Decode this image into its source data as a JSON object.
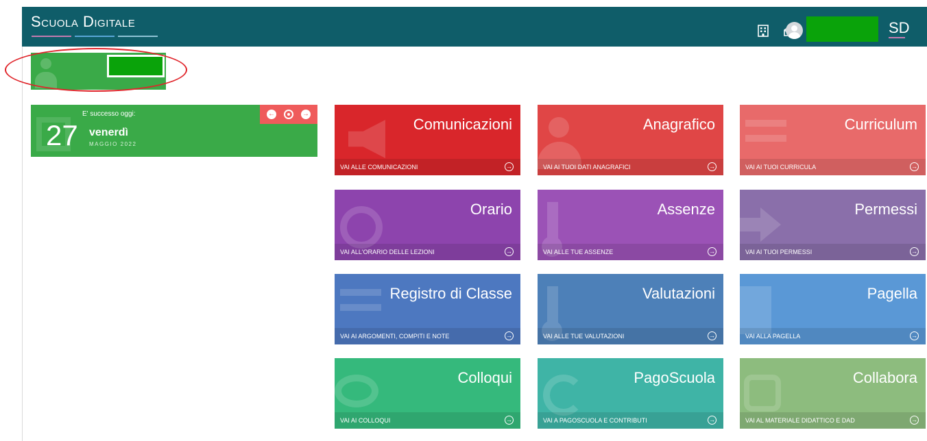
{
  "header": {
    "logo": "Scuola Digitale",
    "logo_small": "SD",
    "icons": [
      "building-icon",
      "mail-icon",
      "user-avatar-icon"
    ],
    "colors": {
      "bar": "#0f5d69",
      "accent_pink": "#c77bb0",
      "accent_blue": "#5aa7d8"
    }
  },
  "today": {
    "label": "E' successo oggi:",
    "day_number": "27",
    "day_name": "venerdì",
    "month_year": "MAGGIO 2022",
    "nav": {
      "prev": "prev-arrow-icon",
      "current": "target-icon",
      "next": "next-arrow-icon"
    }
  },
  "tiles": [
    {
      "title": "Comunicazioni",
      "link": "VAI ALLE COMUNICAZIONI",
      "color": "#d9262b",
      "icon": "megaphone-icon"
    },
    {
      "title": "Anagrafico",
      "link": "VAI AI TUOI DATI ANAGRAFICI",
      "color": "#e04646",
      "icon": "person-icon"
    },
    {
      "title": "Curriculum",
      "link": "VAI AI TUOI CURRICULA",
      "color": "#e86a6a",
      "icon": "list-icon"
    },
    {
      "title": "Orario",
      "link": "VAI ALL'ORARIO DELLE LEZIONI",
      "color": "#8d44ad",
      "icon": "clock-icon"
    },
    {
      "title": "Assenze",
      "link": "VAI ALLE TUE ASSENZE",
      "color": "#9b52b6",
      "icon": "key-icon"
    },
    {
      "title": "Permessi",
      "link": "VAI AI TUOI PERMESSI",
      "color": "#8a6faa",
      "icon": "exit-icon"
    },
    {
      "title": "Registro di Classe",
      "link": "VAI AI ARGOMENTI, COMPITI E NOTE",
      "color": "#4d78c0",
      "icon": "book-icon"
    },
    {
      "title": "Valutazioni",
      "link": "VAI ALLE TUE VALUTAZIONI",
      "color": "#4d80b8",
      "icon": "grade-icon"
    },
    {
      "title": "Pagella",
      "link": "VAI ALLA PAGELLA",
      "color": "#5a98d6",
      "icon": "document-icon"
    },
    {
      "title": "Colloqui",
      "link": "VAI AI COLLOQUI",
      "color": "#35b97c",
      "icon": "chat-icon"
    },
    {
      "title": "PagoScuola",
      "link": "VAI A PAGOSCUOLA E CONTRIBUTI",
      "color": "#3fb4a6",
      "icon": "euro-icon"
    },
    {
      "title": "Collabora",
      "link": "VAI AL MATERIALE DIDATTICO E DAD",
      "color": "#8dbc7e",
      "icon": "puzzle-icon"
    }
  ]
}
